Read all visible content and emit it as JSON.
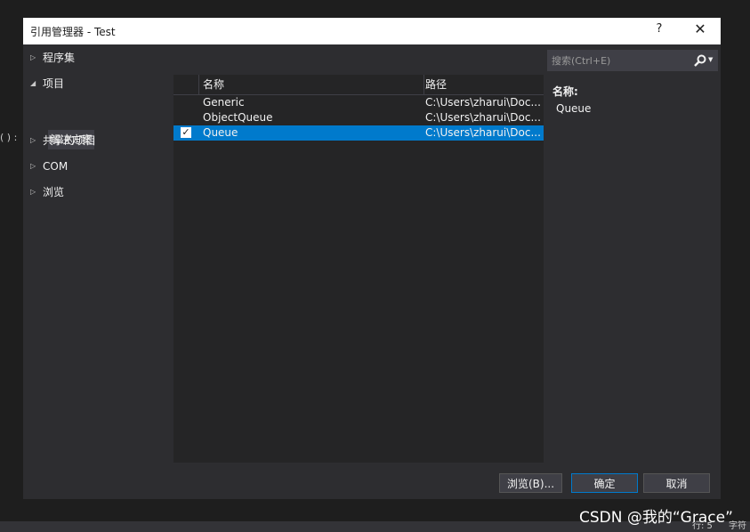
{
  "background": {
    "left_snippet": "( ) :",
    "status_line": "行: 5",
    "status_chars": "字符"
  },
  "dialog": {
    "title": "引用管理器 - Test",
    "help_label": "?",
    "close_label": "✕"
  },
  "nav": {
    "items": [
      {
        "label": "程序集",
        "expanded": false
      },
      {
        "label": "项目",
        "expanded": true
      },
      {
        "label": "共享的项目",
        "expanded": false
      },
      {
        "label": "COM",
        "expanded": false
      },
      {
        "label": "浏览",
        "expanded": false
      }
    ],
    "sub_item": "解决方案"
  },
  "search": {
    "placeholder": "搜索(Ctrl+E)"
  },
  "list": {
    "columns": [
      "名称",
      "路径"
    ],
    "rows": [
      {
        "name": "Generic",
        "path": "C:\\Users\\zharui\\Doc...",
        "checked": false,
        "selected": false
      },
      {
        "name": "ObjectQueue",
        "path": "C:\\Users\\zharui\\Doc...",
        "checked": false,
        "selected": false
      },
      {
        "name": "Queue",
        "path": "C:\\Users\\zharui\\Doc...",
        "checked": true,
        "selected": true
      }
    ]
  },
  "details": {
    "label": "名称:",
    "value": "Queue"
  },
  "buttons": {
    "browse": "浏览(B)...",
    "ok": "确定",
    "cancel": "取消"
  },
  "watermark": "CSDN @我的“Grace”",
  "colors": {
    "accent": "#007acc",
    "dialog_bg": "#2d2d30",
    "panel_bg": "#252526"
  }
}
